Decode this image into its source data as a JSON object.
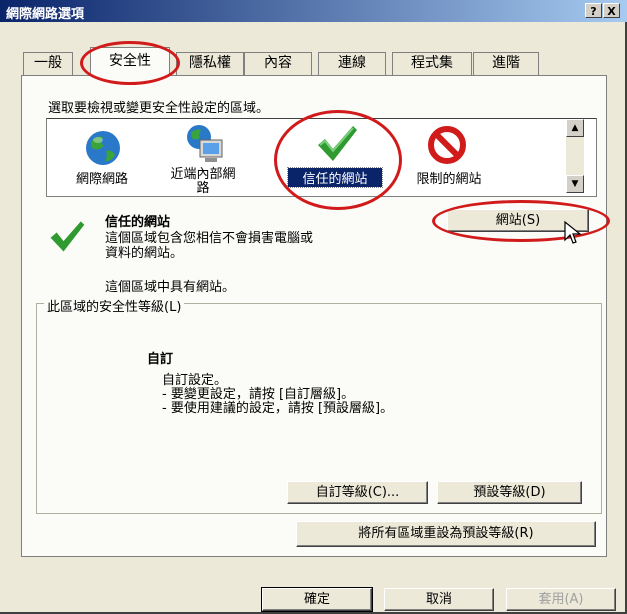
{
  "window": {
    "title": "網際網路選項",
    "help_button": "?",
    "close_button": "X"
  },
  "tabs": [
    {
      "label": "一般"
    },
    {
      "label": "安全性"
    },
    {
      "label": "隱私權"
    },
    {
      "label": "內容"
    },
    {
      "label": "連線"
    },
    {
      "label": "程式集"
    },
    {
      "label": "進階"
    }
  ],
  "security": {
    "zone_prompt": "選取要檢視或變更安全性設定的區域。",
    "zones": [
      {
        "label": "網際網路",
        "icon": "globe-icon"
      },
      {
        "label": "近端內部網路",
        "label_line1": "近端內部網",
        "label_line2": "路",
        "icon": "computer-icon"
      },
      {
        "label": "信任的網站",
        "icon": "checkmark-icon",
        "selected": true
      },
      {
        "label": "限制的網站",
        "icon": "no-entry-icon"
      }
    ],
    "selected_zone": {
      "name": "信任的網站",
      "description_line1": "這個區域包含您相信不會損害電腦或",
      "description_line2": "資料的網站。",
      "sites_note": "這個區域中具有網站。",
      "sites_button": "網站(S)"
    },
    "level_group_title": "此區域的安全性等級(L)",
    "level": {
      "name": "自訂",
      "line1": "自訂設定。",
      "line2": "- 要變更設定，請按 [自訂層級]。",
      "line3": "- 要使用建議的設定，請按 [預設層級]。"
    },
    "custom_level_button": "自訂等級(C)...",
    "default_level_button": "預設等級(D)",
    "reset_all_button": "將所有區域重設為預設等級(R)"
  },
  "footer": {
    "ok_button": "確定",
    "cancel_button": "取消",
    "apply_button": "套用(A)"
  },
  "colors": {
    "titlebar": "#0a246a",
    "selection": "#0a246a",
    "annotation_ring": "#d11a1a"
  }
}
